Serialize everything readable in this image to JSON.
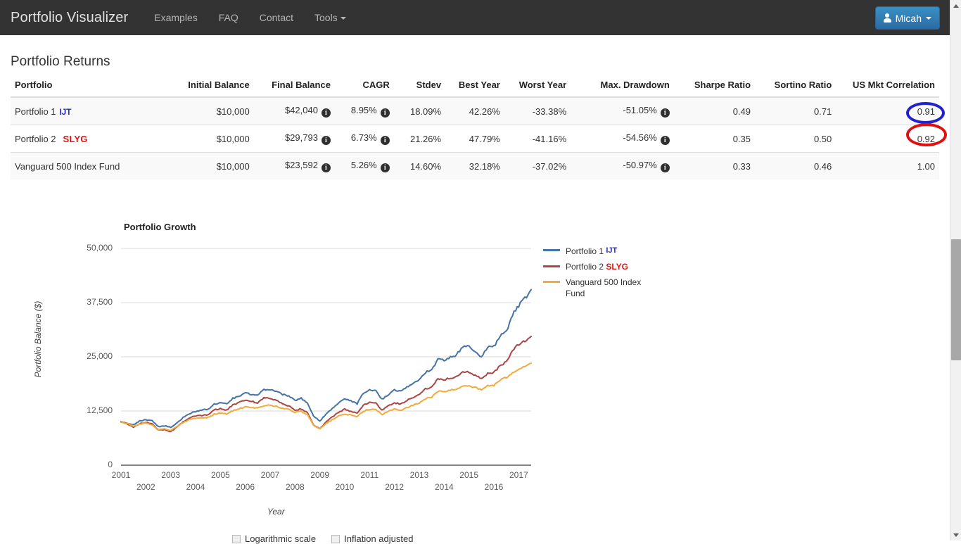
{
  "navbar": {
    "brand": "Portfolio Visualizer",
    "links": [
      {
        "label": "Examples",
        "caret": false
      },
      {
        "label": "FAQ",
        "caret": false
      },
      {
        "label": "Contact",
        "caret": false
      },
      {
        "label": "Tools",
        "caret": true
      }
    ],
    "user": {
      "label": "Micah",
      "icon": "user-icon",
      "caret_icon": "caret-down-icon"
    }
  },
  "page": {
    "title": "Portfolio Returns"
  },
  "table": {
    "columns": [
      "Portfolio",
      "Initial Balance",
      "Final Balance",
      "CAGR",
      "Stdev",
      "Best Year",
      "Worst Year",
      "Max. Drawdown",
      "Sharpe Ratio",
      "Sortino Ratio",
      "US Mkt Correlation"
    ],
    "rows": [
      {
        "portfolio": "Portfolio 1",
        "ticker": "IJT",
        "ticker_color": "#2b2bb5",
        "initial_balance": "$10,000",
        "final_balance": "$42,040",
        "cagr": "8.95%",
        "stdev": "18.09%",
        "best_year": "42.26%",
        "worst_year": "-33.38%",
        "max_drawdown": "-51.05%",
        "sharpe_ratio": "0.49",
        "sortino_ratio": "0.71",
        "us_mkt_correlation": "0.91"
      },
      {
        "portfolio": "Portfolio 2",
        "ticker": "SLYG",
        "ticker_color": "#e41414",
        "initial_balance": "$10,000",
        "final_balance": "$29,793",
        "cagr": "6.73%",
        "stdev": "21.26%",
        "best_year": "47.79%",
        "worst_year": "-41.16%",
        "max_drawdown": "-54.56%",
        "sharpe_ratio": "0.35",
        "sortino_ratio": "0.50",
        "us_mkt_correlation": "0.92"
      },
      {
        "portfolio": "Vanguard 500 Index Fund",
        "ticker": "",
        "ticker_color": "",
        "initial_balance": "$10,000",
        "final_balance": "$23,592",
        "cagr": "5.26%",
        "stdev": "14.60%",
        "best_year": "32.18%",
        "worst_year": "-37.02%",
        "max_drawdown": "-50.97%",
        "sharpe_ratio": "0.33",
        "sortino_ratio": "0.46",
        "us_mkt_correlation": "1.00"
      }
    ]
  },
  "annotations": [
    {
      "name": "blue-ellipse-correlation-portfolio-1",
      "color": "#2222cc",
      "target_value": "0.91"
    },
    {
      "name": "red-ellipse-correlation-portfolio-2",
      "color": "#e01010",
      "target_value": "0.92"
    }
  ],
  "options": {
    "logarithmic_scale": {
      "label": "Logarithmic scale",
      "checked": false
    },
    "inflation_adjusted": {
      "label": "Inflation adjusted",
      "checked": false
    }
  },
  "chart_data": {
    "type": "line",
    "title": "Portfolio Growth",
    "xlabel": "Year",
    "ylabel": "Portfolio Balance ($)",
    "ylim": [
      0,
      50000
    ],
    "yticks": [
      "0",
      "12,500",
      "25,000",
      "37,500",
      "50,000"
    ],
    "ytick_values": [
      0,
      12500,
      25000,
      37500,
      50000
    ],
    "xticks": [
      "2001",
      "2002",
      "2003",
      "2004",
      "2005",
      "2006",
      "2007",
      "2008",
      "2009",
      "2010",
      "2011",
      "2012",
      "2013",
      "2014",
      "2015",
      "2016",
      "2017"
    ],
    "grid": true,
    "legend_position": "right",
    "x": [
      2001.0,
      2001.25,
      2001.5,
      2001.75,
      2002.0,
      2002.25,
      2002.5,
      2002.75,
      2003.0,
      2003.25,
      2003.5,
      2003.75,
      2004.0,
      2004.25,
      2004.5,
      2004.75,
      2005.0,
      2005.25,
      2005.5,
      2005.75,
      2006.0,
      2006.25,
      2006.5,
      2006.75,
      2007.0,
      2007.25,
      2007.5,
      2007.75,
      2008.0,
      2008.25,
      2008.5,
      2008.75,
      2009.0,
      2009.25,
      2009.5,
      2009.75,
      2010.0,
      2010.25,
      2010.5,
      2010.75,
      2011.0,
      2011.25,
      2011.5,
      2011.75,
      2012.0,
      2012.25,
      2012.5,
      2012.75,
      2013.0,
      2013.25,
      2013.5,
      2013.75,
      2014.0,
      2014.25,
      2014.5,
      2014.75,
      2015.0,
      2015.25,
      2015.5,
      2015.75,
      2016.0,
      2016.25,
      2016.5,
      2016.75,
      2017.0,
      2017.25,
      2017.5
    ],
    "series": [
      {
        "name": "Portfolio 1",
        "ticker": "IJT",
        "color": "#4572a7",
        "values": [
          10000,
          9600,
          9300,
          10200,
          10500,
          10300,
          8900,
          9100,
          8700,
          9700,
          11000,
          11900,
          12400,
          12700,
          12900,
          14100,
          14400,
          14100,
          15400,
          16000,
          16600,
          16300,
          16200,
          17400,
          17500,
          17100,
          16300,
          16000,
          15000,
          15400,
          14400,
          11300,
          10200,
          11800,
          13100,
          14300,
          15300,
          14800,
          14200,
          16600,
          17300,
          17100,
          15200,
          16300,
          17400,
          17000,
          18000,
          18800,
          19900,
          21400,
          22000,
          24400,
          24300,
          24900,
          25400,
          27400,
          27300,
          26300,
          25000,
          27300,
          27300,
          29700,
          30800,
          34800,
          36800,
          38400,
          40500
        ]
      },
      {
        "name": "Portfolio 2",
        "ticker": "SLYG",
        "color": "#aa4643",
        "values": [
          10000,
          9500,
          8800,
          9600,
          9900,
          9500,
          8100,
          8200,
          7700,
          8800,
          10000,
          10900,
          11300,
          11500,
          11700,
          12800,
          13000,
          12700,
          13900,
          14500,
          15100,
          14700,
          14400,
          15500,
          15400,
          15000,
          14200,
          13700,
          12700,
          13000,
          12100,
          9300,
          8400,
          9900,
          11100,
          12200,
          12900,
          12400,
          11900,
          13900,
          14500,
          14300,
          12700,
          13600,
          14400,
          14100,
          14900,
          15600,
          16400,
          17600,
          18100,
          19900,
          19800,
          20100,
          20400,
          21700,
          21500,
          20800,
          19800,
          21300,
          21300,
          23000,
          23800,
          26600,
          27900,
          28600,
          29700
        ]
      },
      {
        "name": "Vanguard 500 Index Fund",
        "ticker": "",
        "color": "#f0ab3c",
        "values": [
          10000,
          9600,
          9000,
          9500,
          9700,
          9300,
          8200,
          8400,
          8000,
          8900,
          9800,
          10500,
          10800,
          10900,
          11000,
          11800,
          12000,
          11800,
          12600,
          13000,
          13400,
          13200,
          13100,
          13800,
          13800,
          13600,
          13100,
          12900,
          12200,
          12400,
          11700,
          9200,
          8400,
          9600,
          10500,
          11300,
          11800,
          11500,
          11200,
          12500,
          12900,
          12800,
          11700,
          12400,
          12900,
          12700,
          13300,
          13800,
          14400,
          15300,
          15700,
          17000,
          17000,
          17300,
          17500,
          18400,
          18300,
          17900,
          17300,
          18400,
          18400,
          19600,
          20200,
          21400,
          22200,
          22900,
          23500
        ]
      }
    ]
  }
}
